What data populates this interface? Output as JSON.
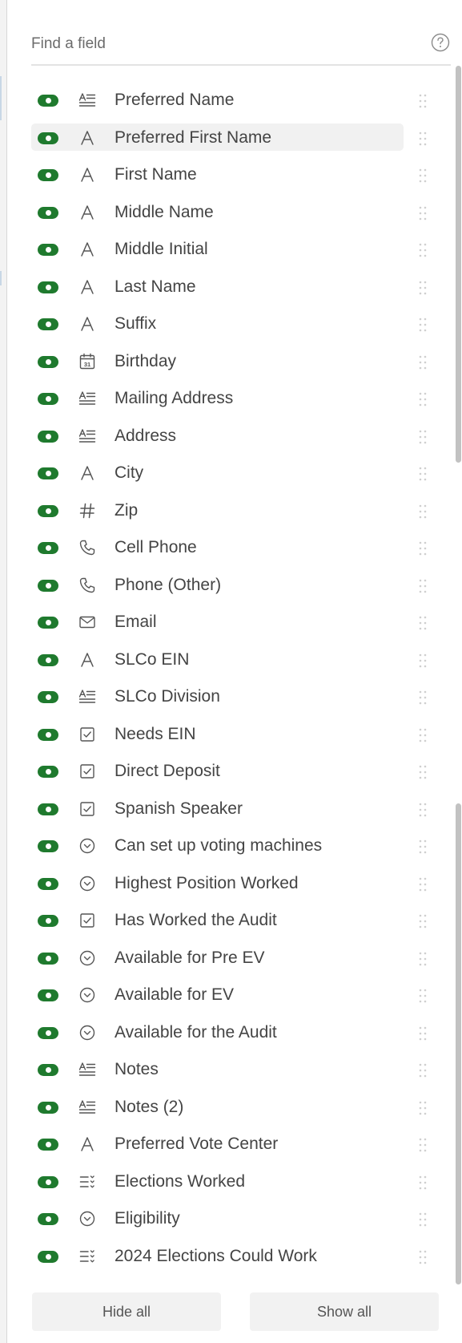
{
  "search": {
    "placeholder": "Find a field"
  },
  "colors": {
    "toggle_on": "#1f7a2e",
    "text": "#444444",
    "icon": "#555555"
  },
  "fields": [
    {
      "label": "Preferred Name",
      "icon": "long-text-icon",
      "enabled": true
    },
    {
      "label": "Preferred First Name",
      "icon": "text-icon",
      "enabled": true,
      "highlighted": true
    },
    {
      "label": "First Name",
      "icon": "text-icon",
      "enabled": true
    },
    {
      "label": "Middle Name",
      "icon": "text-icon",
      "enabled": true
    },
    {
      "label": "Middle Initial",
      "icon": "text-icon",
      "enabled": true
    },
    {
      "label": "Last Name",
      "icon": "text-icon",
      "enabled": true
    },
    {
      "label": "Suffix",
      "icon": "text-icon",
      "enabled": true
    },
    {
      "label": "Birthday",
      "icon": "calendar-icon",
      "enabled": true
    },
    {
      "label": "Mailing Address",
      "icon": "long-text-icon",
      "enabled": true
    },
    {
      "label": "Address",
      "icon": "long-text-icon",
      "enabled": true
    },
    {
      "label": "City",
      "icon": "text-icon",
      "enabled": true
    },
    {
      "label": "Zip",
      "icon": "number-icon",
      "enabled": true
    },
    {
      "label": "Cell Phone",
      "icon": "phone-icon",
      "enabled": true
    },
    {
      "label": "Phone (Other)",
      "icon": "phone-icon",
      "enabled": true
    },
    {
      "label": "Email",
      "icon": "email-icon",
      "enabled": true
    },
    {
      "label": "SLCo EIN",
      "icon": "text-icon",
      "enabled": true
    },
    {
      "label": "SLCo Division",
      "icon": "long-text-icon",
      "enabled": true
    },
    {
      "label": "Needs EIN",
      "icon": "checkbox-icon",
      "enabled": true
    },
    {
      "label": "Direct Deposit",
      "icon": "checkbox-icon",
      "enabled": true
    },
    {
      "label": "Spanish Speaker",
      "icon": "checkbox-icon",
      "enabled": true
    },
    {
      "label": "Can set up voting machines",
      "icon": "single-select-icon",
      "enabled": true
    },
    {
      "label": "Highest Position Worked",
      "icon": "single-select-icon",
      "enabled": true
    },
    {
      "label": "Has Worked the Audit",
      "icon": "checkbox-icon",
      "enabled": true
    },
    {
      "label": "Available for Pre EV",
      "icon": "single-select-icon",
      "enabled": true
    },
    {
      "label": "Available for EV",
      "icon": "single-select-icon",
      "enabled": true
    },
    {
      "label": "Available for the Audit",
      "icon": "single-select-icon",
      "enabled": true
    },
    {
      "label": "Notes",
      "icon": "long-text-icon",
      "enabled": true
    },
    {
      "label": "Notes (2)",
      "icon": "long-text-icon",
      "enabled": true
    },
    {
      "label": "Preferred Vote Center",
      "icon": "text-icon",
      "enabled": true
    },
    {
      "label": "Elections Worked",
      "icon": "multi-select-icon",
      "enabled": true
    },
    {
      "label": "Eligibility",
      "icon": "single-select-icon",
      "enabled": true
    },
    {
      "label": "2024 Elections Could Work",
      "icon": "multi-select-icon",
      "enabled": true
    }
  ],
  "buttons": {
    "hide_all": "Hide all",
    "show_all": "Show all"
  }
}
